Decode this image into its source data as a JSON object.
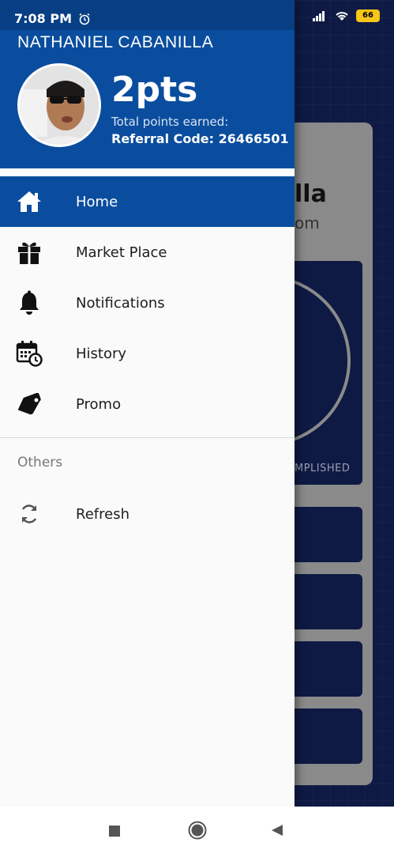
{
  "status_bar": {
    "time": "7:08 PM",
    "battery": "66"
  },
  "background": {
    "name_partial": "lla",
    "email_partial": "om",
    "stat_label_partial": "MPLISHED"
  },
  "drawer": {
    "user_name": "NATHANIEL CABANILLA",
    "points": "2pts",
    "points_label": "Total points earned:",
    "referral": "Referral Code: 26466501",
    "menu": [
      {
        "label": "Home",
        "icon": "home-icon",
        "active": true
      },
      {
        "label": "Market Place",
        "icon": "gift-icon",
        "active": false
      },
      {
        "label": "Notifications",
        "icon": "bell-icon",
        "active": false
      },
      {
        "label": "History",
        "icon": "calendar-clock-icon",
        "active": false
      },
      {
        "label": "Promo",
        "icon": "tag-icon",
        "active": false
      }
    ],
    "section_others": "Others",
    "refresh_label": "Refresh"
  },
  "colors": {
    "primary": "#0a4d9e",
    "drawer_bg": "#fafafa",
    "app_bg": "#0e1a44"
  }
}
